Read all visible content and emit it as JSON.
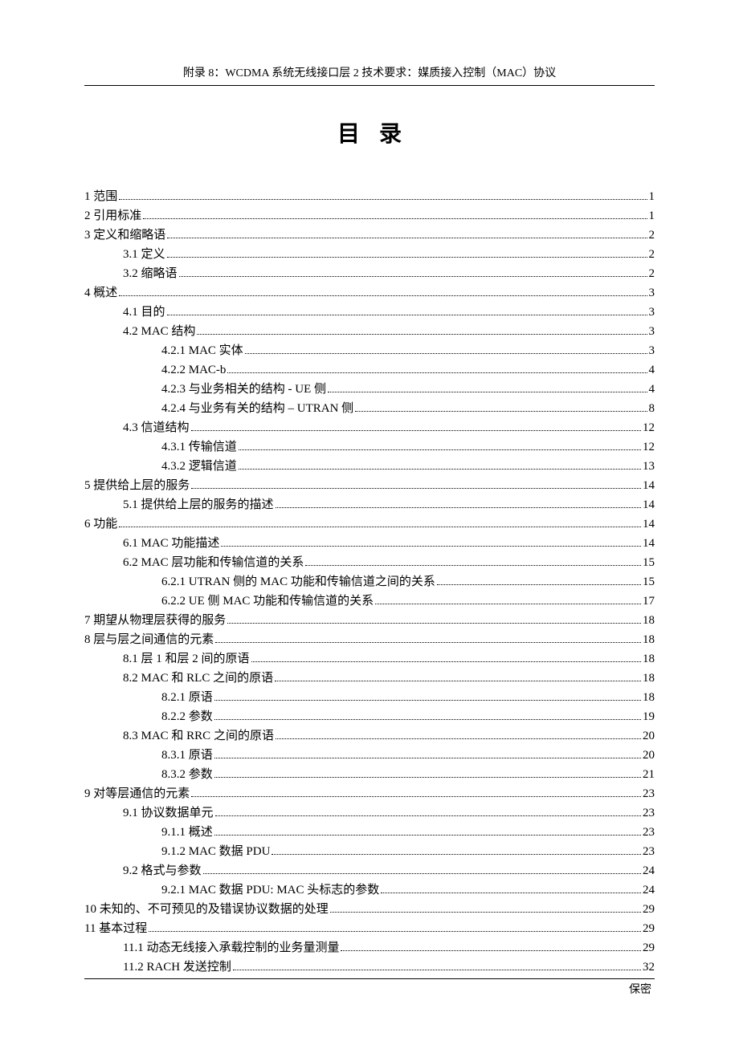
{
  "header": "附录 8：WCDMA 系统无线接口层 2 技术要求：媒质接入控制（MAC）协议",
  "title": "目录",
  "footer": "保密",
  "toc": [
    {
      "indent": 0,
      "label": "1  范围",
      "page": "1"
    },
    {
      "indent": 0,
      "label": "2  引用标准",
      "page": "1"
    },
    {
      "indent": 0,
      "label": "3  定义和缩略语",
      "page": "2"
    },
    {
      "indent": 1,
      "label": "3.1 定义",
      "page": "2"
    },
    {
      "indent": 1,
      "label": "3.2  缩略语",
      "page": "2"
    },
    {
      "indent": 0,
      "label": "4 概述",
      "page": "3"
    },
    {
      "indent": 1,
      "label": "4.1  目的",
      "page": "3"
    },
    {
      "indent": 1,
      "label": "4.2 MAC 结构",
      "page": "3"
    },
    {
      "indent": 2,
      "label": "4.2.1 MAC 实体",
      "page": "3"
    },
    {
      "indent": 2,
      "label": "4.2.2 MAC-b",
      "page": "4"
    },
    {
      "indent": 2,
      "label": "4.2.3  与业务相关的结构  - UE 侧",
      "page": "4"
    },
    {
      "indent": 2,
      "label": "4.2.4  与业务有关的结构  – UTRAN 侧",
      "page": "8"
    },
    {
      "indent": 1,
      "label": "4.3  信道结构",
      "page": "12"
    },
    {
      "indent": 2,
      "label": "4.3.1 传输信道",
      "page": "12"
    },
    {
      "indent": 2,
      "label": "4.3.2 逻辑信道",
      "page": "13"
    },
    {
      "indent": 0,
      "label": "5  提供给上层的服务",
      "page": "14"
    },
    {
      "indent": 1,
      "label": "5.1  提供给上层的服务的描述",
      "page": "14"
    },
    {
      "indent": 0,
      "label": "6  功能",
      "page": "14"
    },
    {
      "indent": 1,
      "label": "6.1 MAC 功能描述",
      "page": "14"
    },
    {
      "indent": 1,
      "label": "6.2        MAC 层功能和传输信道的关系",
      "page": "15"
    },
    {
      "indent": 2,
      "label": "6.2.1    UTRAN 侧的 MAC 功能和传输信道之间的关系",
      "page": "15"
    },
    {
      "indent": 2,
      "label": "6.2.2 UE 侧 MAC 功能和传输信道的关系",
      "page": "17"
    },
    {
      "indent": 0,
      "label": "7  期望从物理层获得的服务",
      "page": "18"
    },
    {
      "indent": 0,
      "label": "8  层与层之间通信的元素",
      "page": "18"
    },
    {
      "indent": 1,
      "label": "8.1  层 1 和层 2 间的原语",
      "page": "18"
    },
    {
      "indent": 1,
      "label": "8.2 MAC 和 RLC 之间的原语",
      "page": "18"
    },
    {
      "indent": 2,
      "label": "8.2.1  原语",
      "page": "18"
    },
    {
      "indent": 2,
      "label": "8.2.2  参数",
      "page": "19"
    },
    {
      "indent": 1,
      "label": "8.3 MAC 和  RRC 之间的原语",
      "page": "20"
    },
    {
      "indent": 2,
      "label": "8.3.1  原语",
      "page": "20"
    },
    {
      "indent": 2,
      "label": "8.3.2  参数",
      "page": "21"
    },
    {
      "indent": 0,
      "label": "9  对等层通信的元素",
      "page": "23"
    },
    {
      "indent": 1,
      "label": "9.1  协议数据单元",
      "page": "23"
    },
    {
      "indent": 2,
      "label": "9.1.1  概述",
      "page": "23"
    },
    {
      "indent": 2,
      "label": "9.1.2 MAC 数据 PDU",
      "page": "23"
    },
    {
      "indent": 1,
      "label": "9.2  格式与参数",
      "page": "24"
    },
    {
      "indent": 2,
      "label": "9.2.1 MAC 数据 PDU: MAC 头标志的参数",
      "page": "24"
    },
    {
      "indent": 0,
      "label": "10  未知的、不可预见的及错误协议数据的处理",
      "page": "29"
    },
    {
      "indent": 0,
      "label": "11  基本过程",
      "page": "29"
    },
    {
      "indent": 1,
      "label": "11.1  动态无线接入承载控制的业务量测量",
      "page": "29"
    },
    {
      "indent": 1,
      "label": "11.2 RACH 发送控制",
      "page": "32"
    }
  ]
}
